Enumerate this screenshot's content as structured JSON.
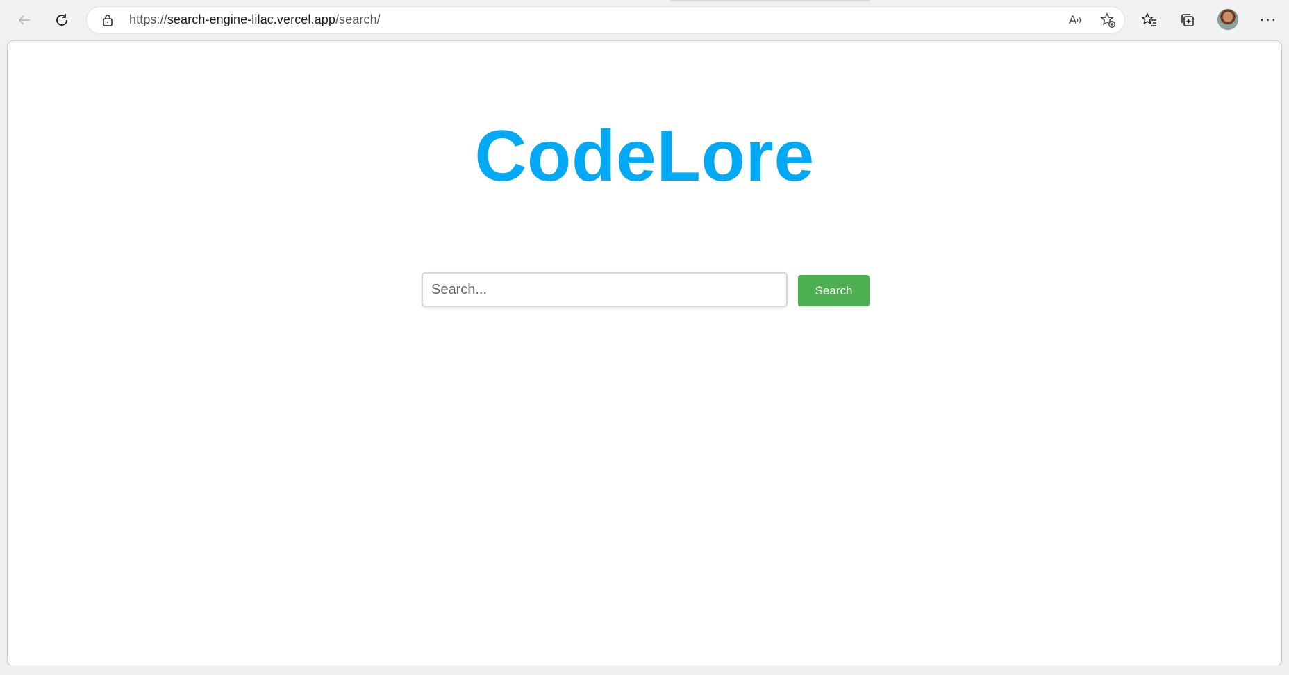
{
  "browser": {
    "url_scheme": "https://",
    "url_host": "search-engine-lilac.vercel.app",
    "url_path": "/search/",
    "read_aloud_label": "A",
    "more_label": "···",
    "icons": {
      "back": "back-arrow-icon",
      "refresh": "refresh-icon",
      "lock": "lock-icon",
      "read_aloud": "read-aloud-icon",
      "add_favorite": "add-favorite-icon",
      "favorites": "favorites-icon",
      "collections": "collections-icon",
      "profile": "profile-avatar",
      "more": "more-options-icon"
    }
  },
  "page": {
    "title": "CodeLore",
    "search": {
      "placeholder": "Search...",
      "value": "",
      "button_label": "Search"
    }
  },
  "colors": {
    "title": "#03a9f4",
    "button": "#4caf50",
    "background": "#ffffff"
  }
}
